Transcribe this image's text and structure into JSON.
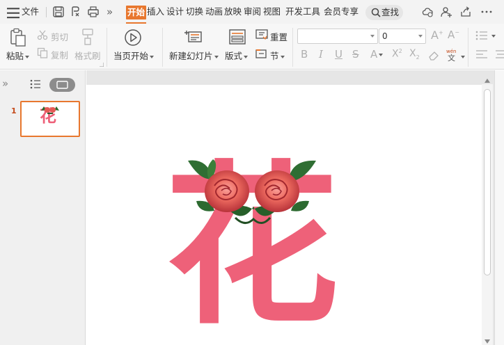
{
  "menubar": {
    "file_label": "文件",
    "tabs": [
      {
        "label": "开始",
        "active": true
      },
      {
        "label": "插入"
      },
      {
        "label": "设计"
      },
      {
        "label": "切换"
      },
      {
        "label": "动画"
      },
      {
        "label": "放映"
      },
      {
        "label": "审阅"
      },
      {
        "label": "视图"
      },
      {
        "label": "开发工具"
      },
      {
        "label": "会员专享"
      }
    ],
    "search_label": "查找",
    "overflow_label": "»"
  },
  "ribbon": {
    "paste": "粘贴",
    "cut": "剪切",
    "copy": "复制",
    "format_painter": "格式刷",
    "from_current": "当页开始",
    "new_slide": "新建幻灯片",
    "layout": "版式",
    "reset": "重置",
    "section": "节",
    "font_size": "0",
    "font_name": ""
  },
  "slide_panel": {
    "slide_number": "1",
    "expand_glyph": "»"
  },
  "slide": {
    "character": "花",
    "thumb_character": "花"
  },
  "colors": {
    "accent": "#e8772e",
    "flower_pink": "#ee6179"
  }
}
